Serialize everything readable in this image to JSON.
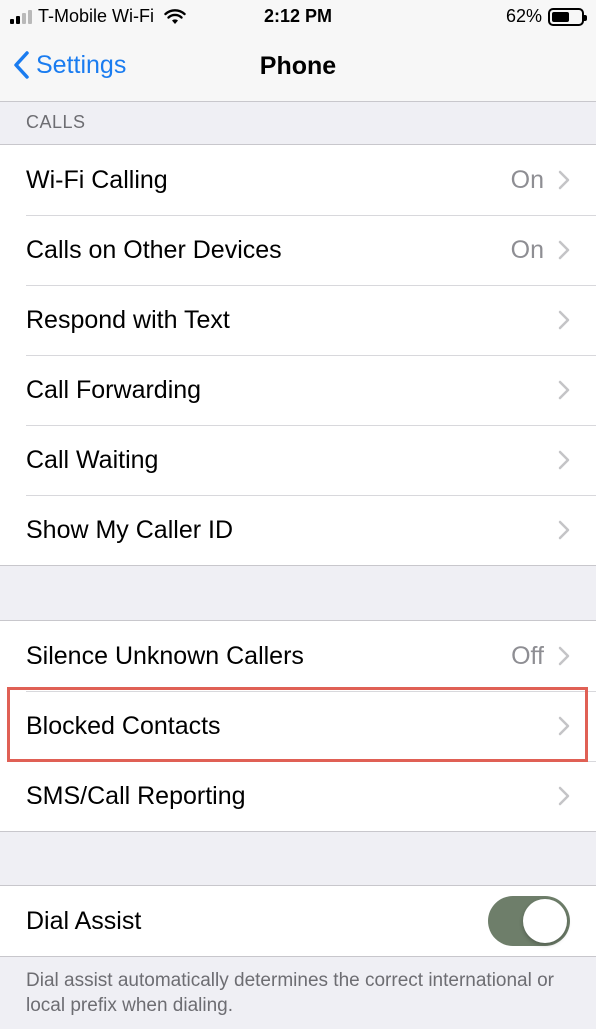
{
  "status_bar": {
    "carrier": "T-Mobile Wi-Fi",
    "time": "2:12 PM",
    "battery_percent": "62%",
    "battery_level": 0.62,
    "signal_bars_filled": 2,
    "signal_bars_total": 4
  },
  "nav": {
    "back_label": "Settings",
    "title": "Phone"
  },
  "calls_section": {
    "header": "CALLS",
    "rows": [
      {
        "label": "Wi-Fi Calling",
        "value": "On"
      },
      {
        "label": "Calls on Other Devices",
        "value": "On"
      },
      {
        "label": "Respond with Text",
        "value": ""
      },
      {
        "label": "Call Forwarding",
        "value": ""
      },
      {
        "label": "Call Waiting",
        "value": ""
      },
      {
        "label": "Show My Caller ID",
        "value": ""
      }
    ]
  },
  "blocking_section": {
    "rows": [
      {
        "label": "Silence Unknown Callers",
        "value": "Off"
      },
      {
        "label": "Blocked Contacts",
        "value": "",
        "highlighted": true
      },
      {
        "label": "SMS/Call Reporting",
        "value": ""
      }
    ]
  },
  "dial_assist": {
    "label": "Dial Assist",
    "enabled": true,
    "footer": "Dial assist automatically determines the correct international or local prefix when dialing."
  },
  "colors": {
    "accent": "#1a7cf0",
    "toggle_on": "#6e7e6a",
    "highlight": "#e06055"
  }
}
